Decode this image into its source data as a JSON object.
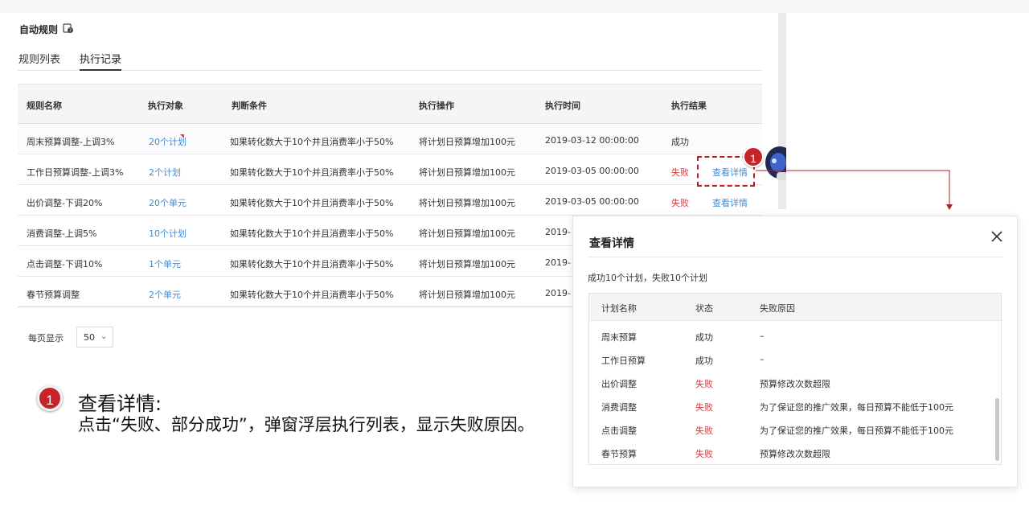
{
  "page": {
    "title": "自动规则",
    "tabs": [
      {
        "label": "规则列表",
        "active": false
      },
      {
        "label": "执行记录",
        "active": true
      }
    ]
  },
  "table": {
    "columns": [
      "规则名称",
      "执行对象",
      "判断条件",
      "执行操作",
      "执行时间",
      "执行结果"
    ],
    "rows": [
      {
        "name": "周末预算调整-上调3%",
        "target": "20个计划",
        "condition": "如果转化数大于10个并且消费率小于50%",
        "action": "将计划日预算增加100元",
        "time": "2019-03-12 00:00:00",
        "result": "成功",
        "status": "success",
        "detail": ""
      },
      {
        "name": "工作日预算调整-上调3%",
        "target": "2个计划",
        "condition": "如果转化数大于10个并且消费率小于50%",
        "action": "将计划日预算增加100元",
        "time": "2019-03-05 00:00:00",
        "result": "失败",
        "status": "fail",
        "detail": "查看详情"
      },
      {
        "name": "出价调整-下调20%",
        "target": "20个单元",
        "condition": "如果转化数大于10个并且消费率小于50%",
        "action": "将计划日预算增加100元",
        "time": "2019-03-05 00:00:00",
        "result": "失败",
        "status": "fail",
        "detail": "查看详情"
      },
      {
        "name": "消费调整-上调5%",
        "target": "10个计划",
        "condition": "如果转化数大于10个并且消费率小于50%",
        "action": "将计划日预算增加100元",
        "time": "2019-",
        "result": "",
        "status": "",
        "detail": ""
      },
      {
        "name": "点击调整-下调10%",
        "target": "1个单元",
        "condition": "如果转化数大于10个并且消费率小于50%",
        "action": "将计划日预算增加100元",
        "time": "2019-",
        "result": "",
        "status": "",
        "detail": ""
      },
      {
        "name": "春节预算调整",
        "target": "2个单元",
        "condition": "如果转化数大于10个并且消费率小于50%",
        "action": "将计划日预算增加100元",
        "time": "2019-",
        "result": "",
        "status": "",
        "detail": ""
      }
    ]
  },
  "pager": {
    "label": "每页显示",
    "value": "50",
    "arrow": "⌄"
  },
  "callout": {
    "number": "1"
  },
  "modal": {
    "title": "查看详情",
    "close": "×",
    "summary": "成功10个计划，失败10个计划",
    "columns": [
      "计划名称",
      "状态",
      "失败原因"
    ],
    "rows": [
      {
        "plan": "周末预算",
        "status": "成功",
        "state": "success",
        "reason": "–"
      },
      {
        "plan": "工作日预算",
        "status": "成功",
        "state": "success",
        "reason": "–"
      },
      {
        "plan": "出价调整",
        "status": "失败",
        "state": "fail",
        "reason": "预算修改次数超限"
      },
      {
        "plan": "消费调整",
        "status": "失败",
        "state": "fail",
        "reason": "为了保证您的推广效果，每日预算不能低于100元"
      },
      {
        "plan": "点击调整",
        "status": "失败",
        "state": "fail",
        "reason": "为了保证您的推广效果，每日预算不能低于100元"
      },
      {
        "plan": "春节预算",
        "status": "失败",
        "state": "fail",
        "reason": "预算修改次数超限"
      }
    ]
  },
  "annotation": {
    "number": "1",
    "title": "查看详情:",
    "body": "点击“失败、部分成功”，弹窗浮层执行列表，显示失败原因。"
  },
  "colors": {
    "link": "#3f8cd9",
    "fail": "#d23c3c",
    "callout": "#c7232a"
  }
}
